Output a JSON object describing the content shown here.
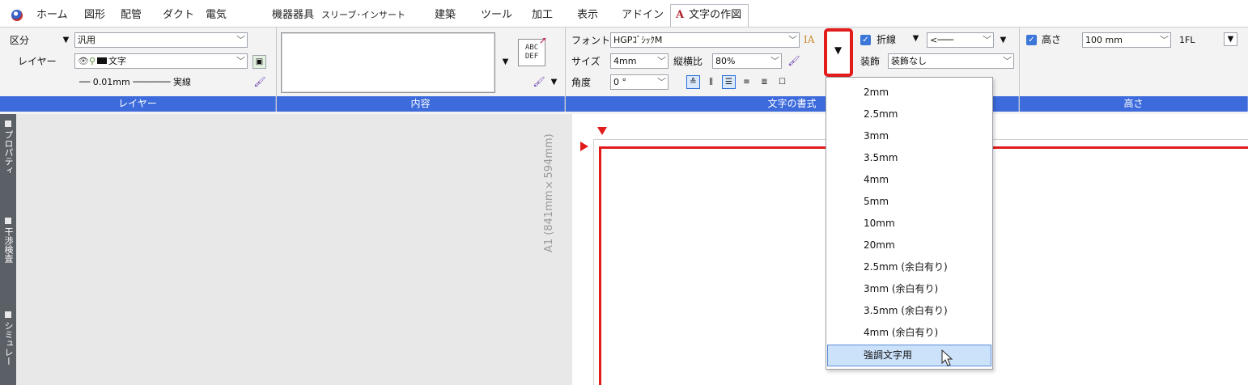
{
  "menu": {
    "items": [
      "ホーム",
      "図形",
      "配管",
      "ダクト",
      "電気",
      "機器器具",
      "スリーブ･インサート",
      "建築",
      "ツール",
      "加工",
      "表示",
      "アドイン"
    ],
    "active_tab": "文字の作図"
  },
  "ribbon": {
    "layer_panel": {
      "caption": "レイヤー",
      "kubun_label": "区分",
      "kubun_value": "汎用",
      "layer_label": "レイヤー",
      "layer_value": "文字",
      "line_width": "0.01mm",
      "line_type": "実線"
    },
    "content_panel": {
      "caption": "内容"
    },
    "format_panel": {
      "caption": "文字の書式",
      "font_label": "フォント",
      "font_value": "HGPｺﾞｼｯｸM",
      "font_icon_text": "IA",
      "size_label": "サイズ",
      "size_value": "4mm",
      "ratio_label": "縦横比",
      "ratio_value": "80%",
      "angle_label": "角度",
      "angle_value": "0 °"
    },
    "line_panel": {
      "polyline_label": "折線",
      "decoration_label": "装飾",
      "decoration_value": "装飾なし"
    },
    "height_panel": {
      "caption": "高さ",
      "height_label": "高さ",
      "height_value": "100 mm",
      "floor_value": "1FL"
    }
  },
  "side_tabs": [
    "プロパティ",
    "干渉検査",
    "シミュレー"
  ],
  "sheet_size": "A1 (841mm×594mm)",
  "size_dropdown": {
    "items": [
      "2mm",
      "2.5mm",
      "3mm",
      "3.5mm",
      "4mm",
      "5mm",
      "10mm",
      "20mm",
      "2.5mm (余白有り)",
      "3mm (余白有り)",
      "3.5mm (余白有り)",
      "4mm (余白有り)",
      "強調文字用"
    ],
    "hovered_item": "強調文字用"
  },
  "colors": {
    "caption_bar": "#3d6bdc",
    "highlight": "#e21b1b",
    "hover": "#cce2fb"
  }
}
